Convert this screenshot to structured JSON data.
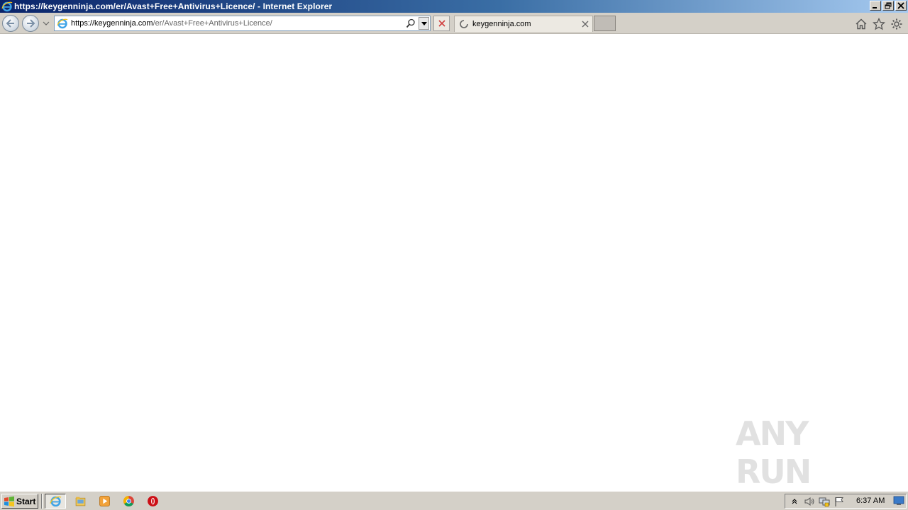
{
  "window": {
    "title": "https://keygenninja.com/er/Avast+Free+Antivirus+Licence/ - Internet Explorer"
  },
  "address_bar": {
    "url_host": "https://keygenninja.com",
    "url_path": "/er/Avast+Free+Antivirus+Licence/"
  },
  "tab": {
    "label": "keygenninja.com"
  },
  "watermark": {
    "text": "ANY RUN"
  },
  "taskbar": {
    "start_label": "Start",
    "clock": "6:37 AM"
  },
  "colors": {
    "titlebar_start": "#0a246a",
    "titlebar_end": "#a6caf0",
    "chrome_gray": "#d4d0c8",
    "stop_red": "#d04040"
  }
}
